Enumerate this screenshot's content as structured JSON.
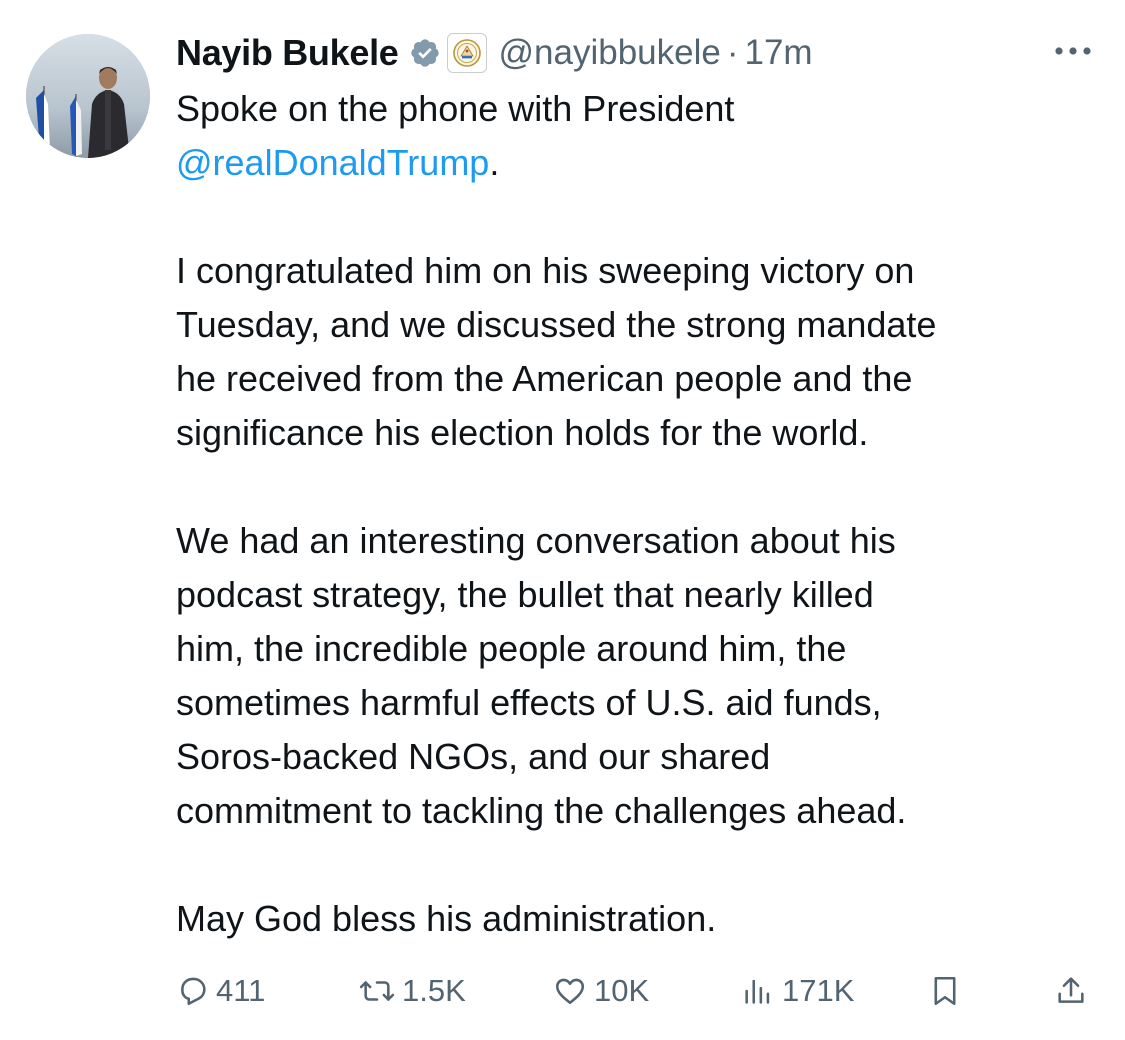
{
  "author": {
    "display_name": "Nayib Bukele",
    "handle": "@nayibbukele",
    "separator": "·",
    "time_ago": "17m",
    "verified_icon": "verified-badge-icon",
    "affiliate_icon": "el-salvador-seal-icon",
    "avatar_icon": "profile-photo"
  },
  "more_icon": "more-options-icon",
  "tweet": {
    "line1": "Spoke on the phone with President",
    "mention": "@realDonaldTrump",
    "mention_suffix": ".",
    "paragraph2": [
      "I congratulated him on his sweeping victory on",
      "Tuesday, and we discussed the strong mandate",
      "he received from the American people and the",
      "significance his election holds for the world."
    ],
    "paragraph3": [
      "We had an interesting conversation about his",
      "podcast strategy, the bullet that nearly killed",
      "him, the incredible people around him, the",
      "sometimes harmful effects of U.S. aid funds,",
      "Soros-backed NGOs, and our shared",
      "commitment to tackling the challenges ahead."
    ],
    "paragraph4": "May God bless his administration."
  },
  "actions": {
    "replies": "411",
    "reposts": "1.5K",
    "likes": "10K",
    "views": "171K",
    "icons": [
      "reply-icon",
      "repost-icon",
      "like-icon",
      "views-icon",
      "bookmark-icon",
      "share-icon"
    ]
  },
  "colors": {
    "text": "#0f1419",
    "secondary": "#536471",
    "link": "#1d9bf0",
    "background": "#ffffff"
  }
}
